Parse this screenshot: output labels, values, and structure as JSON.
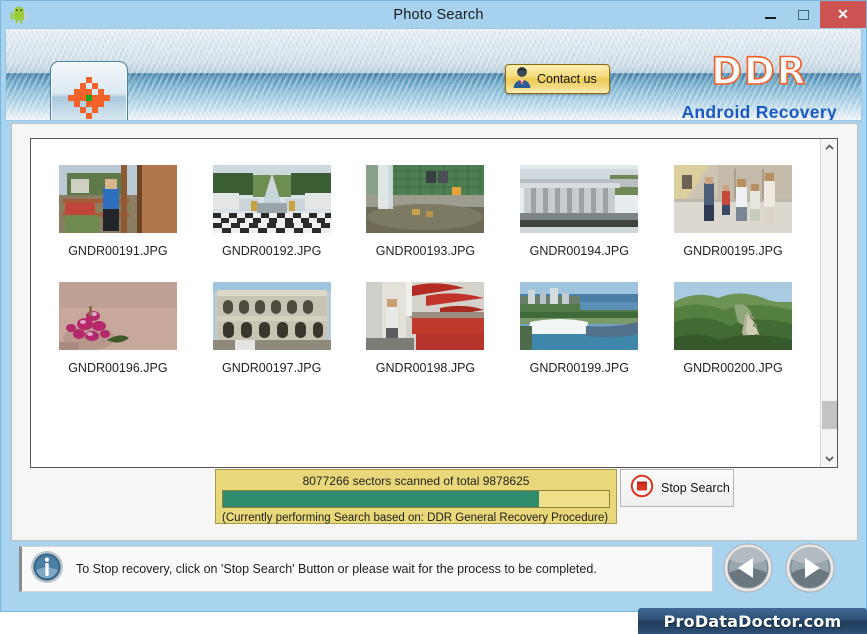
{
  "window": {
    "title": "Photo Search",
    "app_icon": "android-robot-icon",
    "controls": {
      "minimize": "minimize-icon",
      "maximize": "maximize-icon",
      "close": "✕"
    }
  },
  "banner": {
    "logo_icon": "photo-recovery-flower-icon",
    "contact_button": {
      "label": "Contact us",
      "icon": "person-icon"
    },
    "brand_title": "DDR",
    "brand_subtitle": "Android Recovery",
    "brand_color": "#f4602a",
    "subtitle_color": "#1a59c4"
  },
  "photo_grid": {
    "rows": [
      [
        {
          "name": "GNDR00191.JPG",
          "scene": "balcony-boy"
        },
        {
          "name": "GNDR00192.JPG",
          "scene": "palace-fountain"
        },
        {
          "name": "GNDR00193.JPG",
          "scene": "fountain-pool"
        },
        {
          "name": "GNDR00194.JPG",
          "scene": "colonnade-ruins"
        },
        {
          "name": "GNDR00195.JPG",
          "scene": "children-plaza"
        }
      ],
      [
        {
          "name": "GNDR00196.JPG",
          "scene": "pink-flowers"
        },
        {
          "name": "GNDR00197.JPG",
          "scene": "roman-amphitheatre"
        },
        {
          "name": "GNDR00198.JPG",
          "scene": "cafe-red-umbrellas"
        },
        {
          "name": "GNDR00199.JPG",
          "scene": "niagara-falls"
        },
        {
          "name": "GNDR00200.JPG",
          "scene": "great-wall"
        }
      ]
    ]
  },
  "scrollbar": {
    "up_icon": "chevron-up-icon",
    "down_icon": "chevron-down-icon"
  },
  "progress": {
    "label": "8077266 sectors scanned of total 9878625",
    "sectors_scanned": 8077266,
    "sectors_total": 9878625,
    "percent": 81.8,
    "sub_label": "(Currently performing Search based on:  DDR General Recovery Procedure)",
    "fill_color": "#2e8b6b",
    "box_color": "#e8d87a"
  },
  "stop_button": {
    "label": "Stop Search",
    "icon": "stop-square-icon",
    "icon_color": "#d8341d"
  },
  "info_bar": {
    "icon": "info-circle-icon",
    "text": "To Stop recovery, click on 'Stop Search' Button or please wait for the process to be completed."
  },
  "navigation": {
    "back_icon": "arrow-left-icon",
    "next_icon": "arrow-right-icon"
  },
  "footer": {
    "text": "ProDataDoctor.com"
  }
}
